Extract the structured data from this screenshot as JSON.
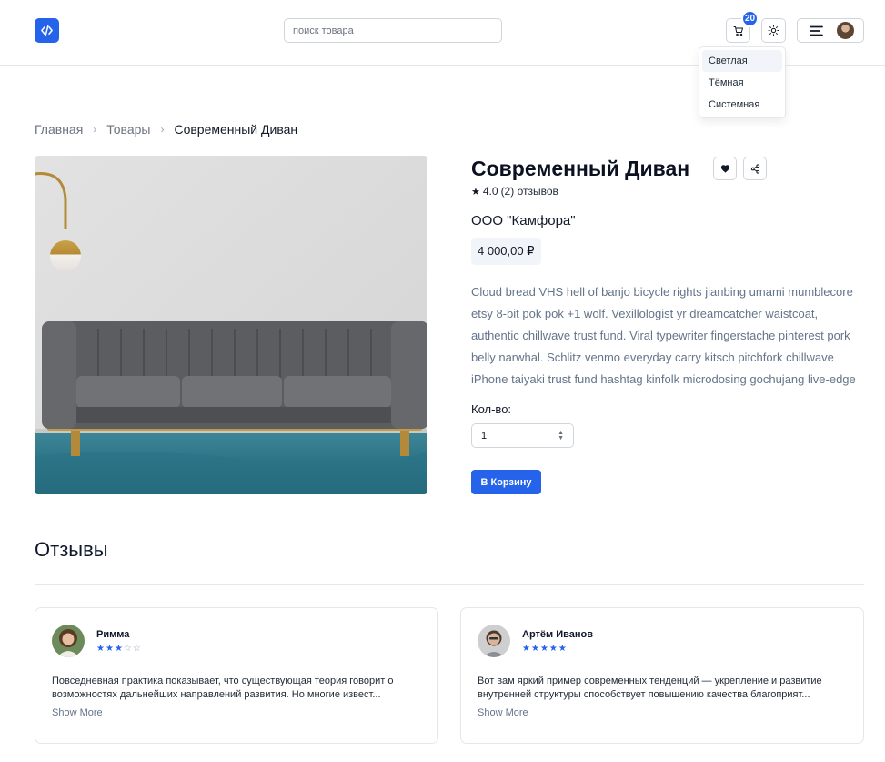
{
  "header": {
    "search_placeholder": "поиск товара",
    "cart_count": "20"
  },
  "theme_menu": {
    "items": [
      "Светлая",
      "Тёмная",
      "Системная"
    ],
    "selected": "Светлая"
  },
  "breadcrumb": {
    "home": "Главная",
    "products": "Товары",
    "current": "Современный Диван"
  },
  "product": {
    "title": "Современный Диван",
    "rating": "4.0",
    "reviews_text": "(2) отзывов",
    "seller": "ООО \"Камфора\"",
    "price": "4 000,00 ₽",
    "description": "Cloud bread VHS hell of banjo bicycle rights jianbing umami mumblecore etsy 8-bit pok pok +1 wolf. Vexillologist yr dreamcatcher waistcoat, authentic chillwave trust fund. Viral typewriter fingerstache pinterest pork belly narwhal. Schlitz venmo everyday carry kitsch pitchfork chillwave iPhone taiyaki trust fund hashtag kinfolk microdosing gochujang live-edge",
    "qty_label": "Кол-во:",
    "qty_value": "1",
    "add_to_cart": "В Корзину"
  },
  "reviews": {
    "title": "Отзывы",
    "items": [
      {
        "name": "Римма",
        "stars": 3,
        "text": "Повседневная практика показывает, что существующая теория говорит о возможностях дальнейших направлений развития. Но многие извест...",
        "more": "Show More"
      },
      {
        "name": "Артём Иванов",
        "stars": 5,
        "text": "Вот вам яркий пример современных тенденций — укрепление и развитие внутренней структуры способствует повышению качества благоприят...",
        "more": "Show More"
      }
    ]
  },
  "colors": {
    "accent": "#2563eb",
    "muted_text": "#64748b",
    "border": "#e5e7eb"
  }
}
